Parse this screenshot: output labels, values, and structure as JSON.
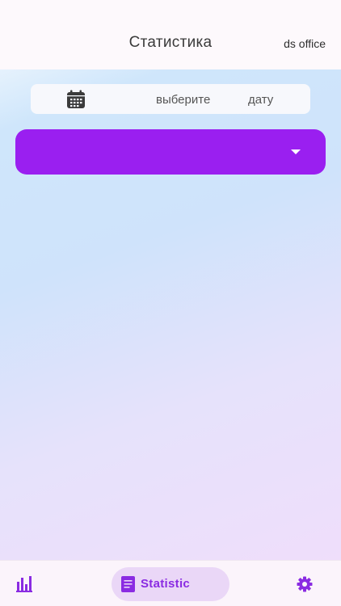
{
  "header": {
    "title": "Статистика",
    "office": "ds office"
  },
  "date_picker": {
    "icon": "calendar-icon",
    "word1": "выберите",
    "word2": "дату"
  },
  "dropdown": {
    "selected": "",
    "icon": "dropdown-arrow-icon",
    "color": "#9a1ff0"
  },
  "bottom_nav": {
    "items": [
      {
        "icon": "bar-chart-icon",
        "label": "",
        "active": false
      },
      {
        "icon": "document-icon",
        "label": "Statistic",
        "active": true
      },
      {
        "icon": "gear-icon",
        "label": "",
        "active": false
      }
    ],
    "accent": "#8a2be2"
  }
}
